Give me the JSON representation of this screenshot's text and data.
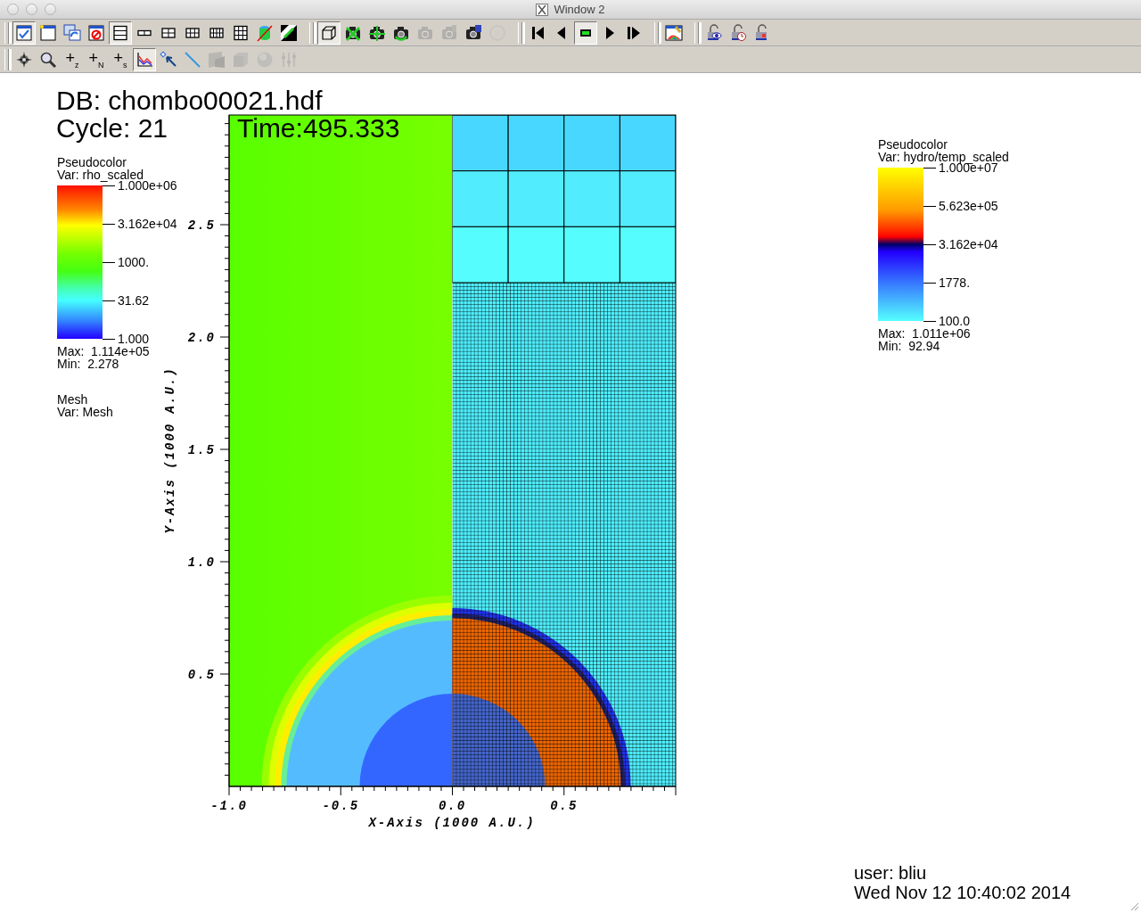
{
  "window": {
    "title": "Window 2"
  },
  "toolbars": [
    {
      "groups": [
        [
          {
            "kind": "check-window",
            "selected": true,
            "disabled": false
          },
          {
            "kind": "new-window",
            "selected": false,
            "disabled": false
          },
          {
            "kind": "clone-window",
            "selected": false,
            "disabled": false
          },
          {
            "kind": "delete-window",
            "selected": false,
            "disabled": false
          },
          {
            "kind": "layout-1",
            "selected": true,
            "disabled": false
          },
          {
            "kind": "layout-2",
            "selected": false,
            "disabled": false
          },
          {
            "kind": "layout-4",
            "selected": false,
            "disabled": false
          },
          {
            "kind": "layout-6",
            "selected": false,
            "disabled": false
          },
          {
            "kind": "layout-8",
            "selected": false,
            "disabled": false
          },
          {
            "kind": "layout-9",
            "selected": false,
            "disabled": false
          },
          {
            "kind": "spin",
            "selected": false,
            "disabled": false
          },
          {
            "kind": "invert",
            "selected": false,
            "disabled": false
          }
        ],
        [
          {
            "kind": "cube",
            "selected": true,
            "disabled": false
          },
          {
            "kind": "camera-x",
            "selected": false,
            "disabled": false
          },
          {
            "kind": "camera-arrows",
            "selected": false,
            "disabled": false
          },
          {
            "kind": "camera-rotate",
            "selected": false,
            "disabled": false
          },
          {
            "kind": "camera",
            "selected": false,
            "disabled": true
          },
          {
            "kind": "camera-film",
            "selected": false,
            "disabled": true
          },
          {
            "kind": "camera-save",
            "selected": false,
            "disabled": false
          },
          {
            "kind": "ghost",
            "selected": false,
            "disabled": true
          }
        ],
        [
          {
            "kind": "step-back",
            "selected": false,
            "disabled": false
          },
          {
            "kind": "reverse",
            "selected": false,
            "disabled": false
          },
          {
            "kind": "stop",
            "selected": true,
            "disabled": false
          },
          {
            "kind": "play",
            "selected": false,
            "disabled": false
          },
          {
            "kind": "step-forward",
            "selected": false,
            "disabled": false
          }
        ],
        [
          {
            "kind": "palette",
            "selected": false,
            "disabled": false
          }
        ],
        [
          {
            "kind": "lock-view",
            "selected": false,
            "disabled": false
          },
          {
            "kind": "lock-time",
            "selected": false,
            "disabled": false
          },
          {
            "kind": "lock-tools",
            "selected": false,
            "disabled": false
          }
        ]
      ]
    },
    {
      "groups": [
        [
          {
            "kind": "navigate",
            "selected": false,
            "disabled": false
          },
          {
            "kind": "zoom",
            "selected": false,
            "disabled": false
          },
          {
            "kind": "text",
            "label": "+$_{z}$",
            "selected": false,
            "disabled": false
          },
          {
            "kind": "text",
            "label": "+$_{N}$",
            "selected": false,
            "disabled": false
          },
          {
            "kind": "text",
            "label": "+$_{s}$",
            "selected": false,
            "disabled": false
          },
          {
            "kind": "curve",
            "selected": true,
            "disabled": false
          },
          {
            "kind": "pick",
            "selected": false,
            "disabled": false
          },
          {
            "kind": "line",
            "selected": false,
            "disabled": false
          },
          {
            "kind": "plane",
            "selected": false,
            "disabled": true
          },
          {
            "kind": "box",
            "selected": false,
            "disabled": true
          },
          {
            "kind": "sphere",
            "selected": false,
            "disabled": true
          },
          {
            "kind": "sliders",
            "selected": false,
            "disabled": true
          }
        ]
      ]
    }
  ],
  "plot": {
    "database": "DB: chombo00021.hdf",
    "cycle": "Cycle: 21",
    "time": "Time:495.333",
    "x_axis": {
      "title": "X-Axis (1000 A.U.)",
      "tick_labels": [
        "-1.0",
        "-0.5",
        "0.0",
        "0.5"
      ]
    },
    "y_axis": {
      "title": "Y-Axis (1000 A.U.)",
      "tick_labels": [
        "2.5",
        "2.0",
        "1.5",
        "1.0",
        "0.5"
      ]
    }
  },
  "legends": [
    {
      "kind": "rainbow",
      "plot": "Pseudocolor",
      "variable": "Var: rho_scaled",
      "ticks": [
        "1.000e+06",
        "3.162e+04",
        "1000.",
        "31.62",
        "1.000"
      ],
      "max": "Max:  1.114e+05",
      "min": "Min:  2.278"
    },
    {
      "kind": "mesh",
      "plot": "Mesh",
      "variable": "Var: Mesh"
    },
    {
      "kind": "temperature",
      "plot": "Pseudocolor",
      "variable": "Var: hydro/temp_scaled",
      "ticks": [
        "1.000e+07",
        "5.623e+05",
        "3.162e+04",
        "1778.",
        "100.0"
      ],
      "max": "Max:  1.011e+06",
      "min": "Min:  92.94"
    }
  ],
  "user": "user: bliu",
  "date": "Wed Nov 12 10:40:02 2014"
}
